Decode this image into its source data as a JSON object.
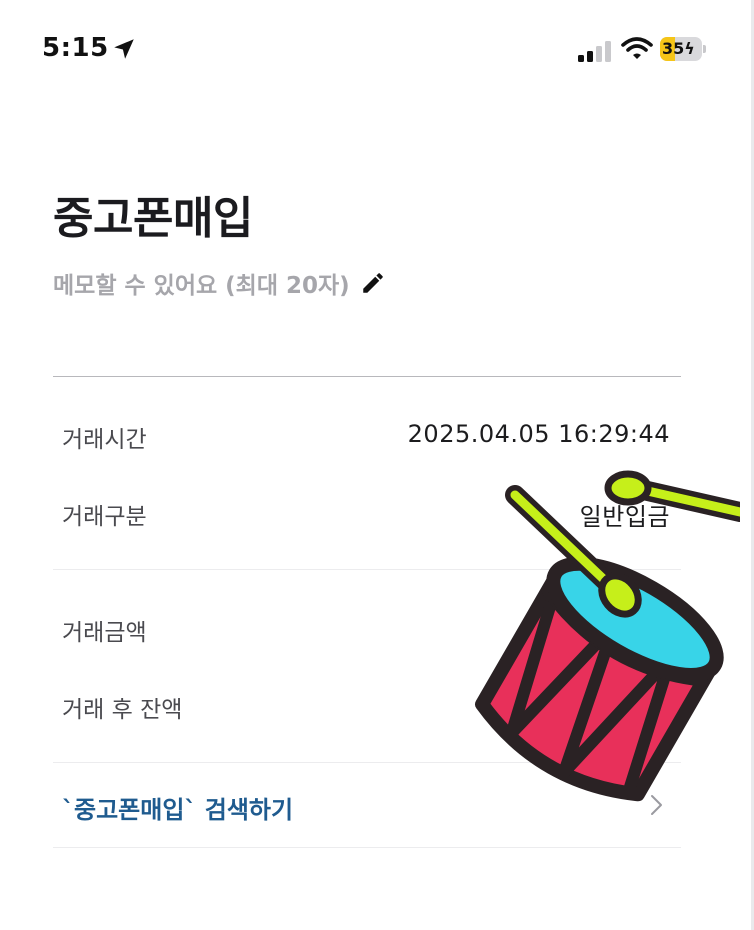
{
  "status_bar": {
    "time": "5:15",
    "battery": "35",
    "battery_level_percent": 35,
    "icons": [
      "location-arrow-icon",
      "cellular-signal-icon",
      "wifi-icon",
      "battery-charging-icon"
    ]
  },
  "header": {
    "title": "중고폰매입",
    "memo_placeholder": "메모할 수 있어요 (최대 20자)",
    "memo_edit_icon": "pencil-icon"
  },
  "details": {
    "group1": [
      {
        "label": "거래시간",
        "value": "2025.04.05 16:29:44"
      },
      {
        "label": "거래구분",
        "value": "일반입금"
      }
    ],
    "group2": [
      {
        "label": "거래금액",
        "value": ""
      },
      {
        "label": "거래 후 잔액",
        "value": ""
      }
    ]
  },
  "search_link": {
    "label": "`중고폰매입` 검색하기",
    "icon": "chevron-right-icon"
  },
  "overlay": {
    "sticker": "drum-sticker",
    "colors": {
      "drum_red": "#e8305a",
      "drum_top": "#38d4e8",
      "stick": "#c6ef1a",
      "outline": "#2a2224"
    }
  },
  "colors": {
    "link": "#1f5b8f",
    "placeholder": "#a6a6ab",
    "battery": "#f5c518"
  }
}
